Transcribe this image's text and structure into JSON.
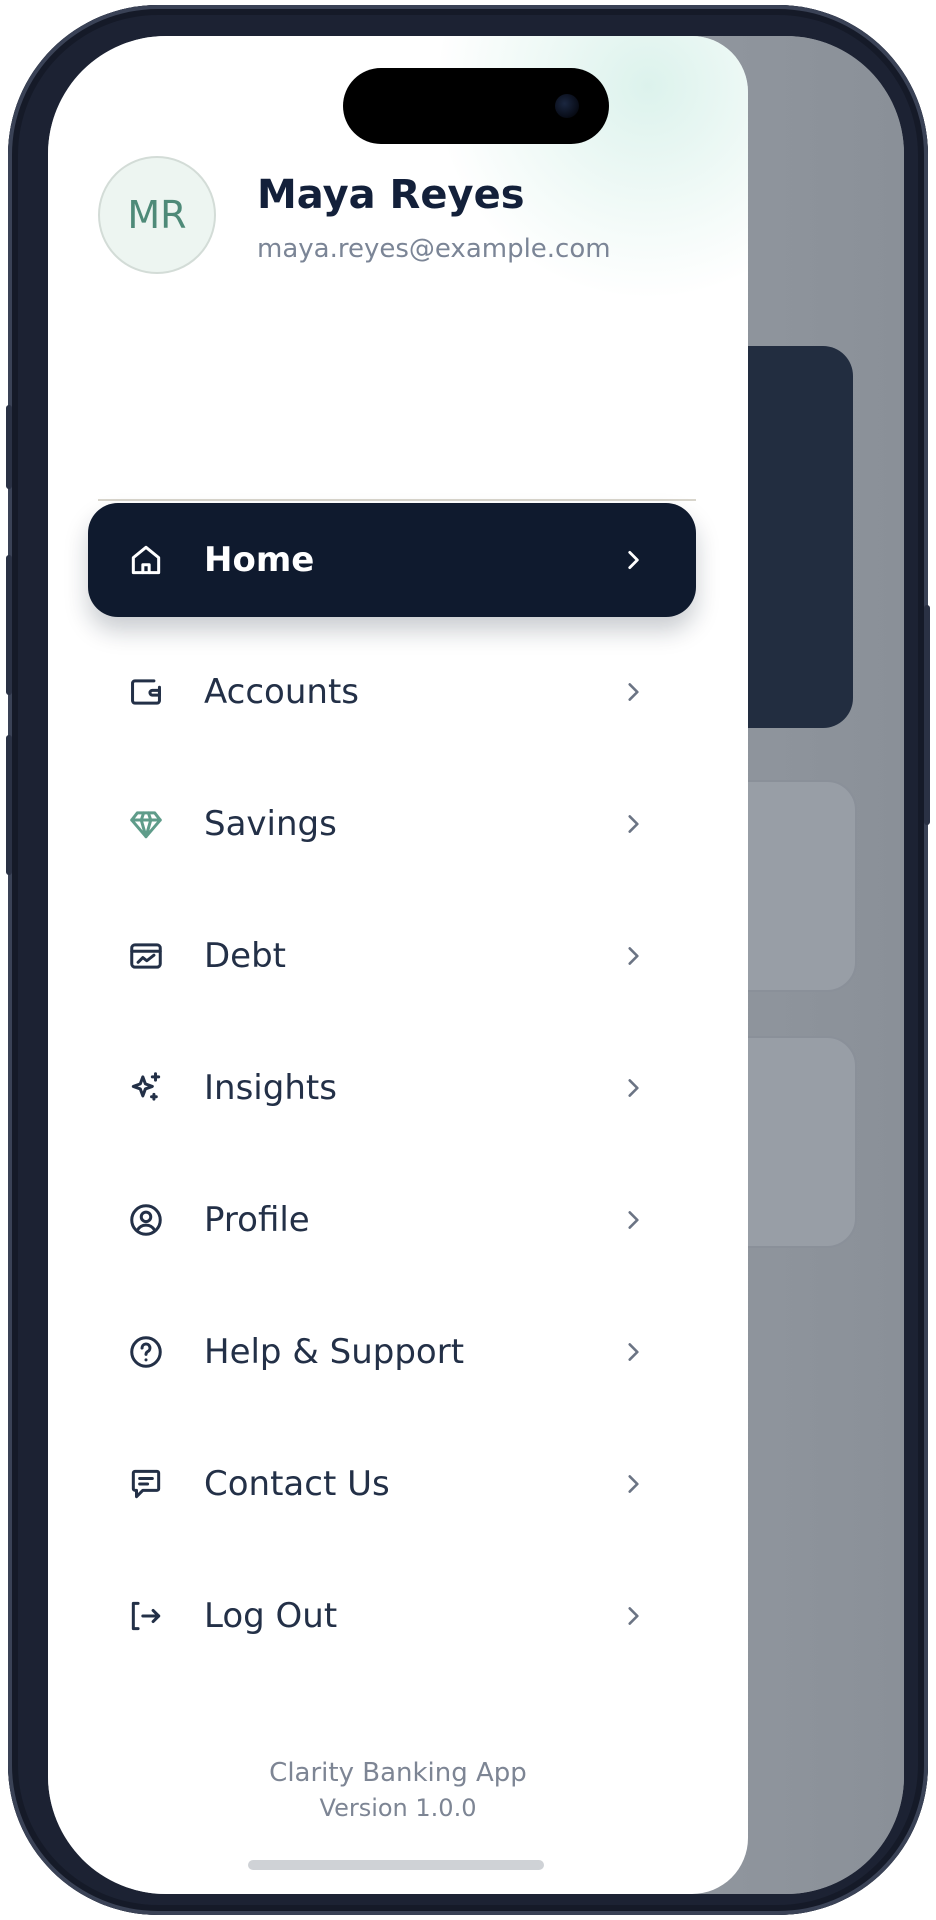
{
  "user": {
    "initials": "MR",
    "name": "Maya Reyes",
    "email": "maya.reyes@example.com"
  },
  "nav": {
    "items": [
      {
        "label": "Home",
        "icon": "home-icon",
        "active": true
      },
      {
        "label": "Accounts",
        "icon": "wallet-icon"
      },
      {
        "label": "Savings",
        "icon": "diamond-icon"
      },
      {
        "label": "Debt",
        "icon": "card-chart-icon"
      },
      {
        "label": "Insights",
        "icon": "sparkles-icon"
      },
      {
        "label": "Profile",
        "icon": "user-circle-icon"
      },
      {
        "label": "Help & Support",
        "icon": "help-circle-icon"
      },
      {
        "label": "Contact Us",
        "icon": "chat-icon"
      },
      {
        "label": "Log Out",
        "icon": "logout-icon"
      }
    ]
  },
  "footer": {
    "app_name": "Clarity Banking App",
    "version": "Version 1.0.0"
  },
  "colors": {
    "accent_dark": "#0f1a2e",
    "text_primary": "#13203a",
    "savings_icon": "#5f9c8a"
  }
}
